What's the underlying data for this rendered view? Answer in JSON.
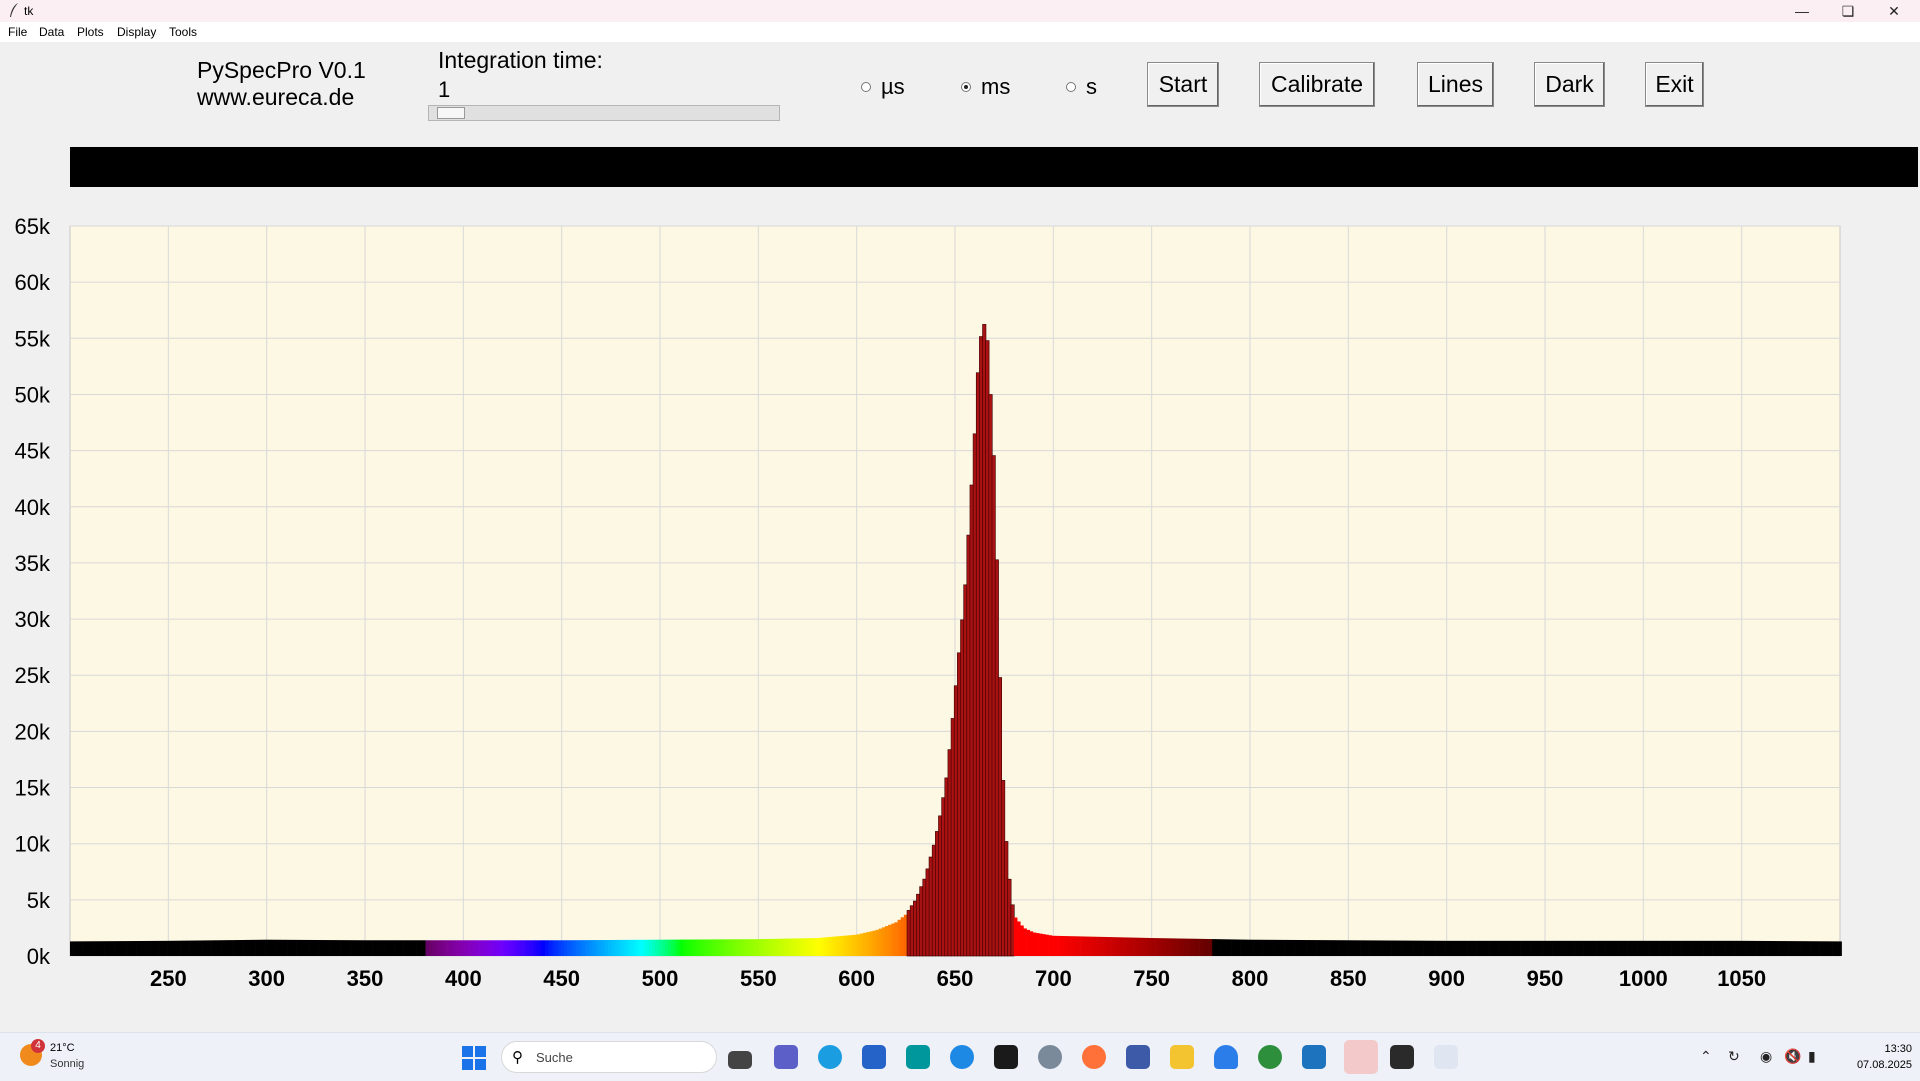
{
  "window": {
    "title": "tk"
  },
  "menu": [
    "File",
    "Data",
    "Plots",
    "Display",
    "Tools"
  ],
  "app": {
    "title_line1": "PySpecPro V0.1",
    "title_line2": "www.eureca.de",
    "integration_label": "Integration time:",
    "integration_value": "1",
    "slider_value_fraction": 0.02,
    "units": [
      {
        "label": "µs",
        "selected": false
      },
      {
        "label": "ms",
        "selected": true
      },
      {
        "label": "s",
        "selected": false
      }
    ],
    "buttons": [
      "Start",
      "Calibrate",
      "Lines",
      "Dark",
      "Exit"
    ]
  },
  "chart_data": {
    "type": "bar",
    "xlim": [
      200,
      1100
    ],
    "ylim": [
      0,
      65000
    ],
    "x_ticks": [
      250,
      300,
      350,
      400,
      450,
      500,
      550,
      600,
      650,
      700,
      750,
      800,
      850,
      900,
      950,
      1000,
      1050
    ],
    "y_ticks": [
      0,
      5000,
      10000,
      15000,
      20000,
      25000,
      30000,
      35000,
      40000,
      45000,
      50000,
      55000,
      60000,
      65000
    ],
    "y_tick_labels": [
      "0k",
      "5k",
      "10k",
      "15k",
      "20k",
      "25k",
      "30k",
      "35k",
      "40k",
      "45k",
      "50k",
      "55k",
      "60k",
      "65k"
    ],
    "grid": true,
    "background": "#fdf8e4",
    "bar_color_scheme": "wavelength spectrum",
    "series": [
      {
        "x": [
          200,
          250,
          300,
          350,
          400,
          450,
          500,
          550,
          580,
          600,
          610,
          620,
          625,
          630,
          635,
          640,
          643,
          646,
          649,
          652,
          655,
          658,
          660,
          662,
          664,
          666,
          668,
          670,
          672,
          674,
          676,
          678,
          680,
          685,
          690,
          700,
          750,
          800,
          850,
          900,
          950,
          1000,
          1050,
          1100
        ],
        "values": [
          1300,
          1350,
          1450,
          1400,
          1400,
          1400,
          1450,
          1500,
          1600,
          1900,
          2300,
          3000,
          3700,
          5000,
          7100,
          10400,
          13000,
          16300,
          21500,
          27000,
          32500,
          40800,
          46500,
          53300,
          56400,
          56000,
          50000,
          43200,
          30000,
          17000,
          10200,
          6000,
          3600,
          2500,
          2100,
          1800,
          1600,
          1450,
          1400,
          1350,
          1350,
          1350,
          1350,
          1300
        ]
      }
    ]
  },
  "taskbar": {
    "weather_temp": "21°C",
    "weather_cond": "Sonnig",
    "weather_badge": "4",
    "search_placeholder": "Suche",
    "time": "13:30",
    "date": "07.08.2025",
    "icons": [
      "task-view-icon",
      "teams-icon",
      "edge-icon",
      "store-icon",
      "arduino-icon",
      "app-icon",
      "terminal-icon",
      "network-app-icon",
      "firefox-icon",
      "remote-icon",
      "explorer-icon",
      "arc-icon",
      "hs-icon",
      "notepad-icon",
      "active-app-icon",
      "console-icon",
      "python-tk-icon"
    ]
  }
}
